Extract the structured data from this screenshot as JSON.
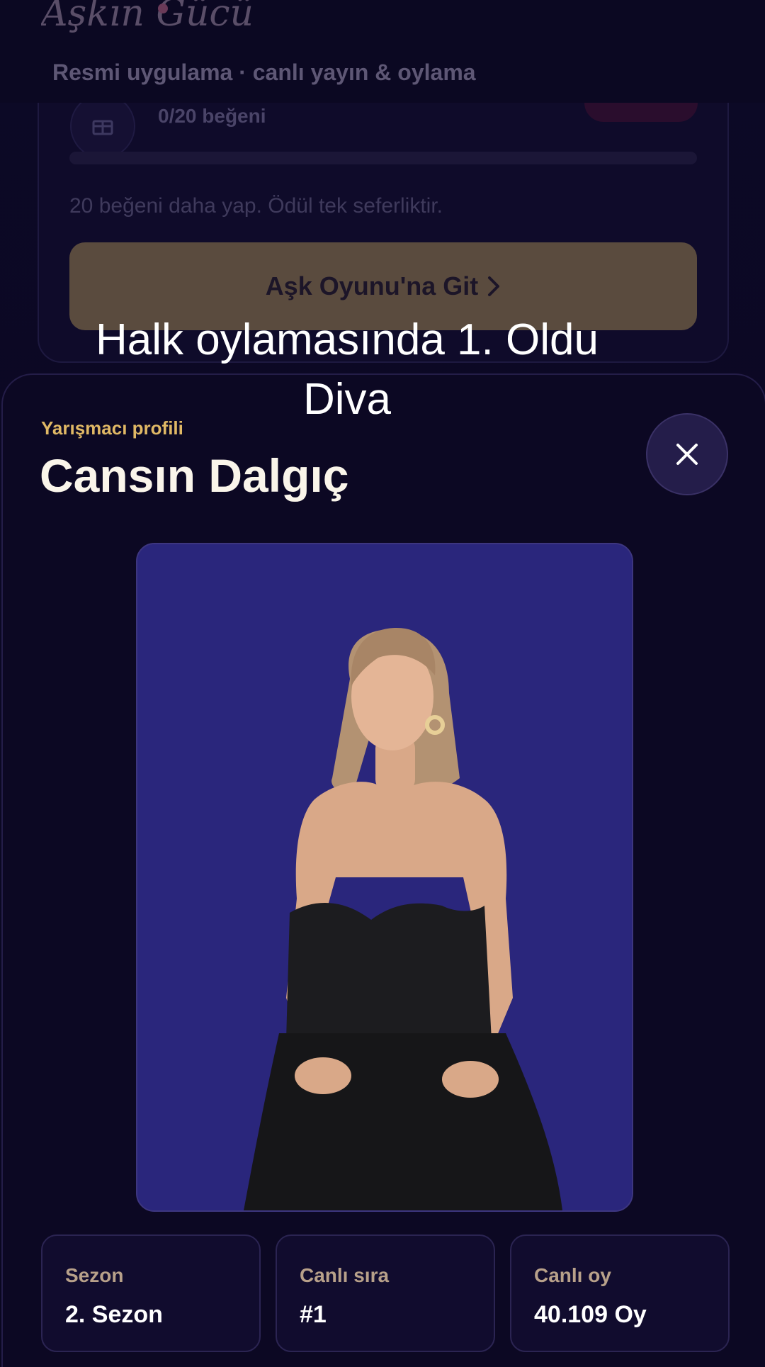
{
  "header": {
    "logo_text": "Aşkın Gücü",
    "subtitle": "Resmi uygulama · canlı yayın & oylama"
  },
  "reward": {
    "like_count": "0/20 beğeni",
    "progress_fraction": 0,
    "hint": "20 beğeni daha yap. Ödül tek seferliktir.",
    "button_label": "Aşk Oyunu'na Git"
  },
  "caption": {
    "line1": "Halk oylamasında 1. Oldu",
    "line2": "Diva"
  },
  "profile": {
    "eyebrow": "Yarışmacı profili",
    "name": "Cansın Dalgıç",
    "stats": [
      {
        "label": "Sezon",
        "value": "2. Sezon"
      },
      {
        "label": "Canlı sıra",
        "value": "#1"
      },
      {
        "label": "Canlı oy",
        "value": "40.109 Oy"
      }
    ]
  },
  "colors": {
    "accent_gold": "#e0b865",
    "background": "#0a0720",
    "photo_background": "#2a267c"
  },
  "icons": {
    "close": "close-icon",
    "gift": "gift-icon",
    "chevron": "chevron-right-icon"
  }
}
